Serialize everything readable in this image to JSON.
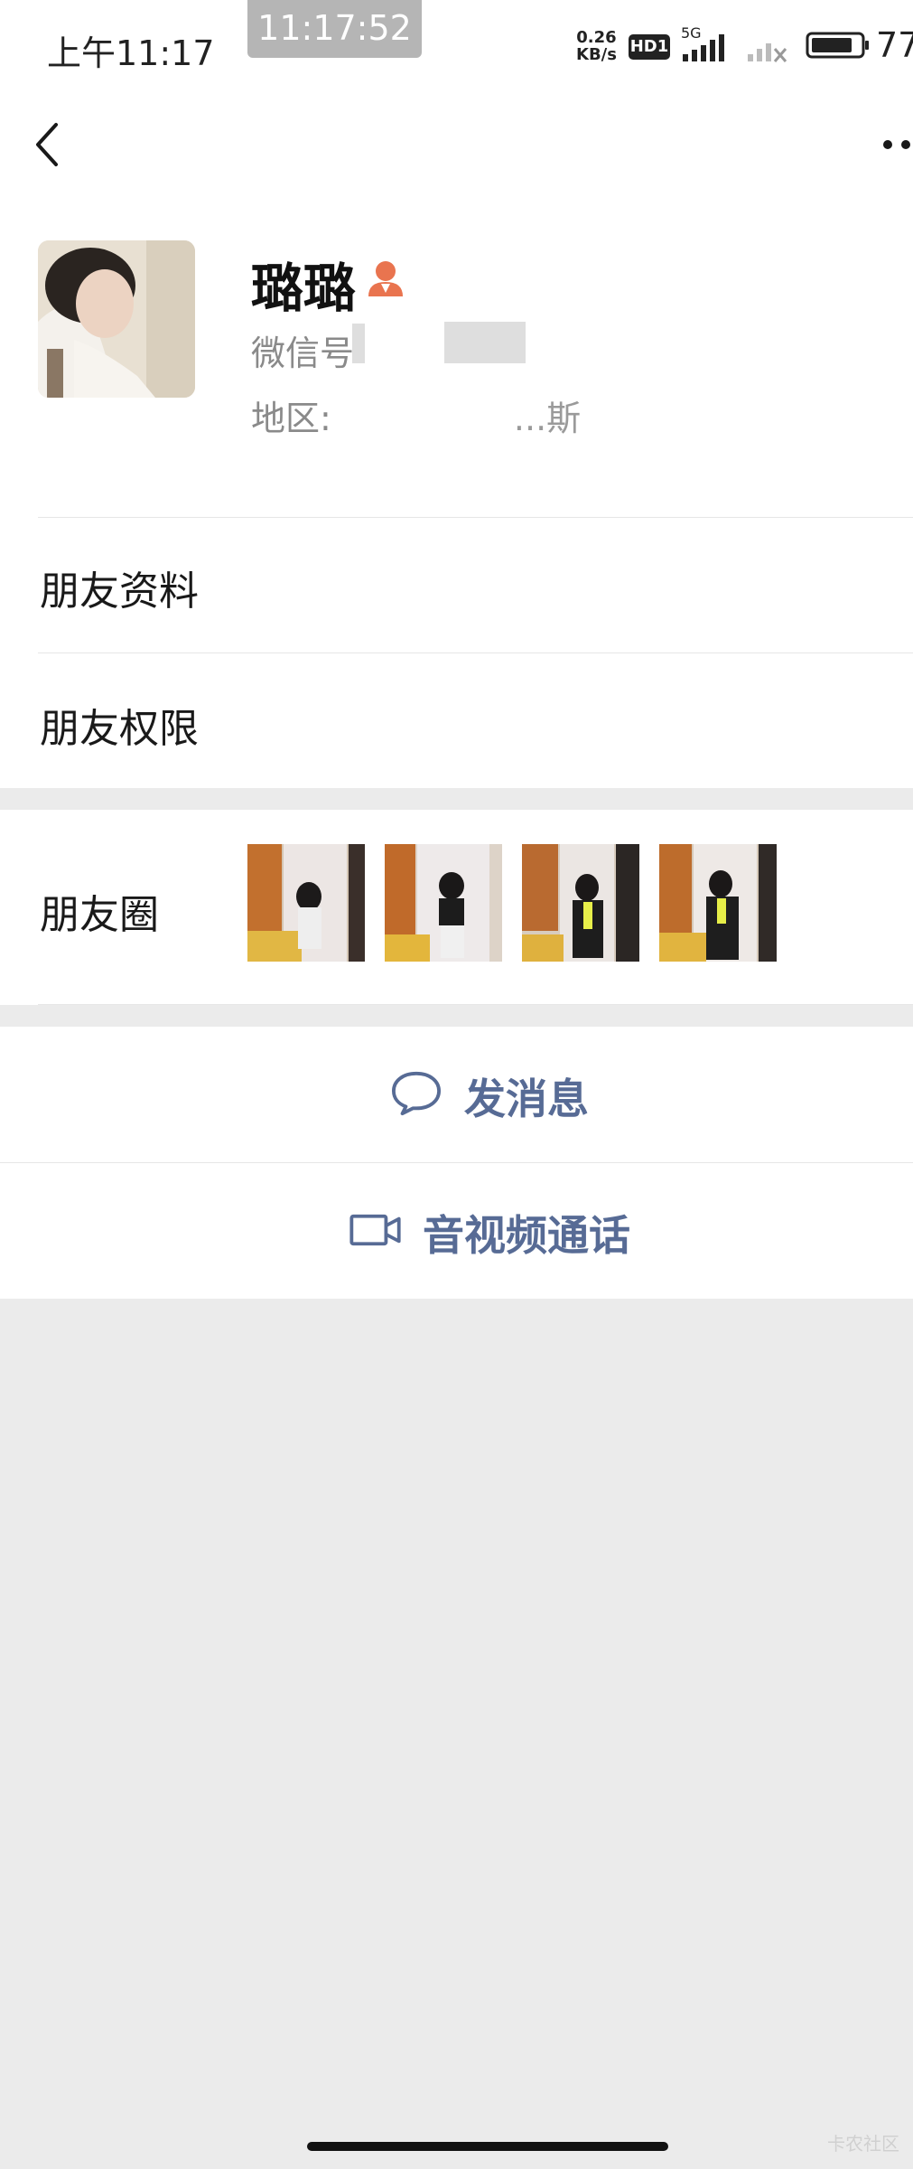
{
  "status_bar": {
    "time": "上午11:17",
    "timer": "11:17:52",
    "speed_value": "0.26",
    "speed_unit": "KB/s",
    "hd_badge": "HD1",
    "network_label": "5G",
    "battery_percent": "77"
  },
  "profile": {
    "name": "璐璐",
    "wechat_id_label": "微信号",
    "region_label": "地区:",
    "region_visible_fragment": "...斯"
  },
  "menu": {
    "friend_info": "朋友资料",
    "friend_permissions": "朋友权限",
    "moments": "朋友圈"
  },
  "actions": {
    "send_message": "发消息",
    "video_call": "音视频通话"
  },
  "watermark": "卡农社区",
  "icons": {
    "back": "back-arrow-icon",
    "more": "more-dots-icon",
    "gender": "female-gender-icon",
    "chat": "chat-bubble-icon",
    "video": "video-camera-icon"
  },
  "colors": {
    "accent_link": "#576b95",
    "gender_badge": "#e9744f",
    "page_bg": "#ebebeb"
  }
}
